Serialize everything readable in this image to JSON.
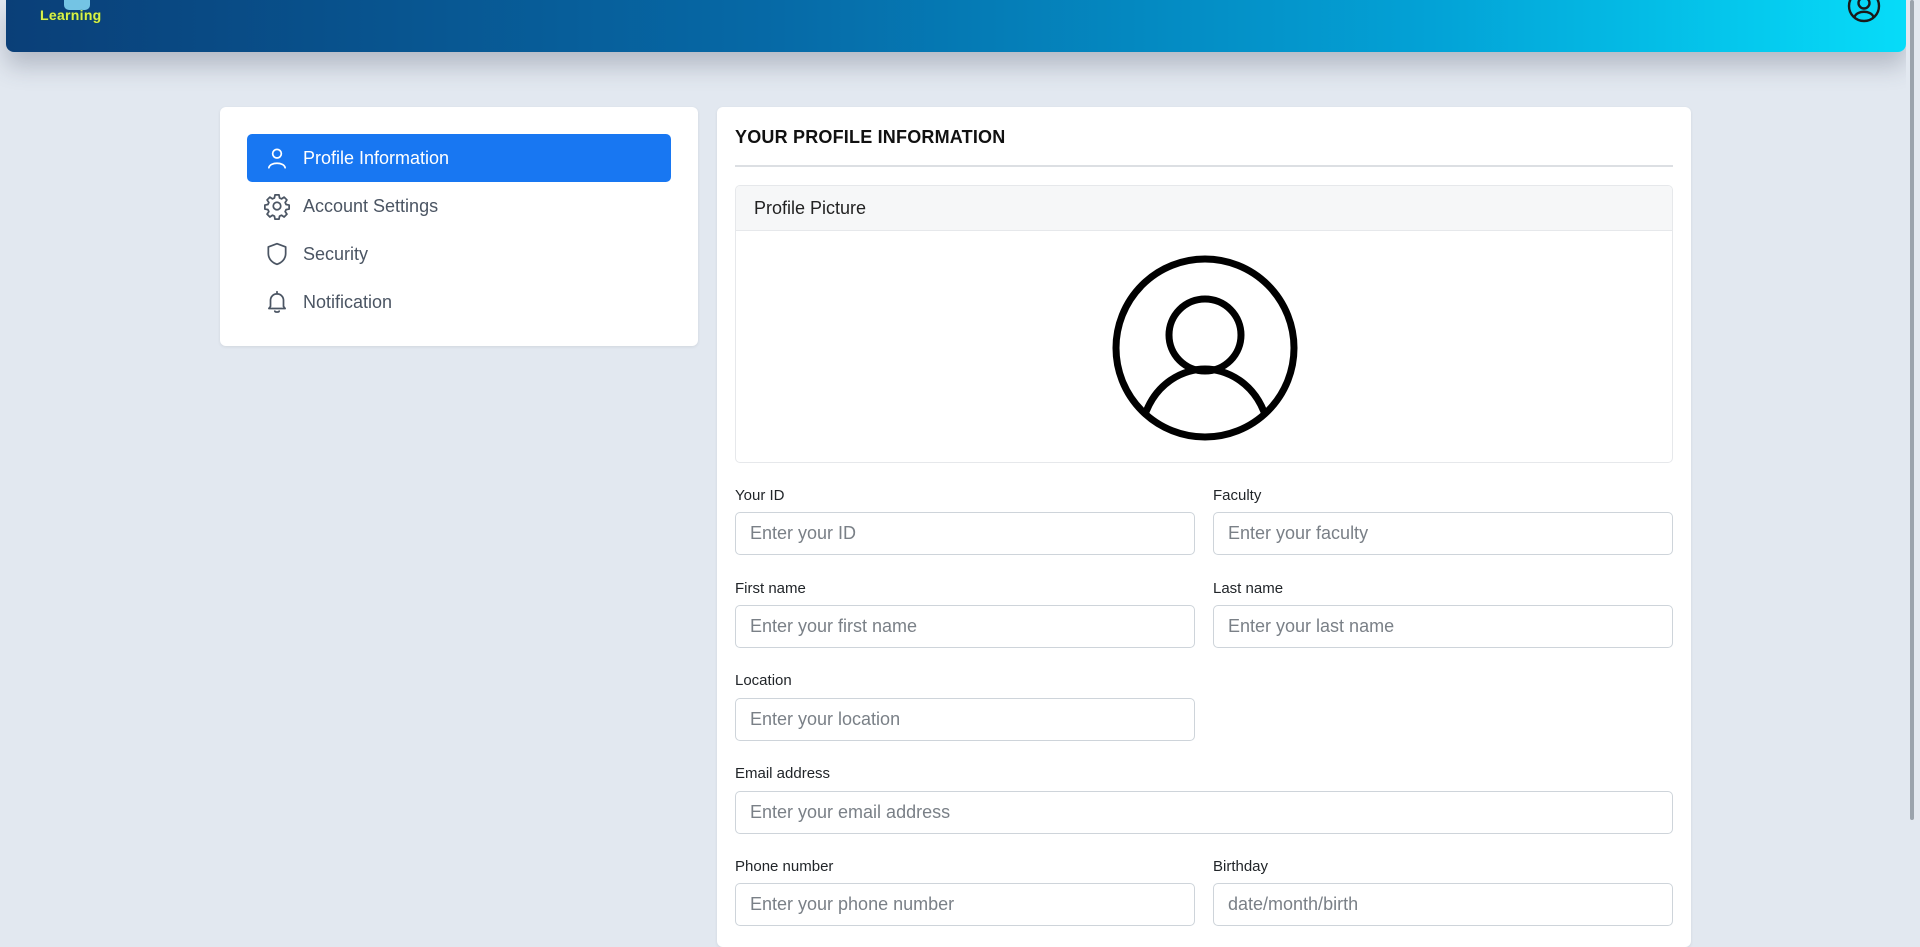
{
  "header": {
    "logo_text": "Learning"
  },
  "sidebar": {
    "items": [
      {
        "label": "Profile Information",
        "icon": "user-icon",
        "active": true
      },
      {
        "label": "Account Settings",
        "icon": "gear-icon",
        "active": false
      },
      {
        "label": "Security",
        "icon": "shield-icon",
        "active": false
      },
      {
        "label": "Notification",
        "icon": "bell-icon",
        "active": false
      }
    ]
  },
  "main": {
    "title": "YOUR PROFILE INFORMATION",
    "picture_panel": {
      "header": "Profile Picture",
      "icon": "user-circle-icon"
    },
    "fields": {
      "id": {
        "label": "Your ID",
        "placeholder": "Enter your ID",
        "value": ""
      },
      "faculty": {
        "label": "Faculty",
        "placeholder": "Enter your faculty",
        "value": ""
      },
      "first_name": {
        "label": "First name",
        "placeholder": "Enter your first name",
        "value": ""
      },
      "last_name": {
        "label": "Last name",
        "placeholder": "Enter your last name",
        "value": ""
      },
      "location": {
        "label": "Location",
        "placeholder": "Enter your location",
        "value": ""
      },
      "email": {
        "label": "Email address",
        "placeholder": "Enter your email address",
        "value": ""
      },
      "phone": {
        "label": "Phone number",
        "placeholder": "Enter your phone number",
        "value": ""
      },
      "birthday": {
        "label": "Birthday",
        "placeholder": "date/month/birth",
        "value": ""
      }
    }
  },
  "colors": {
    "accent": "#1877f2",
    "page_background": "#e2e8f0",
    "header_gradient_start": "#0a3f78",
    "header_gradient_end": "#06dcf9"
  }
}
